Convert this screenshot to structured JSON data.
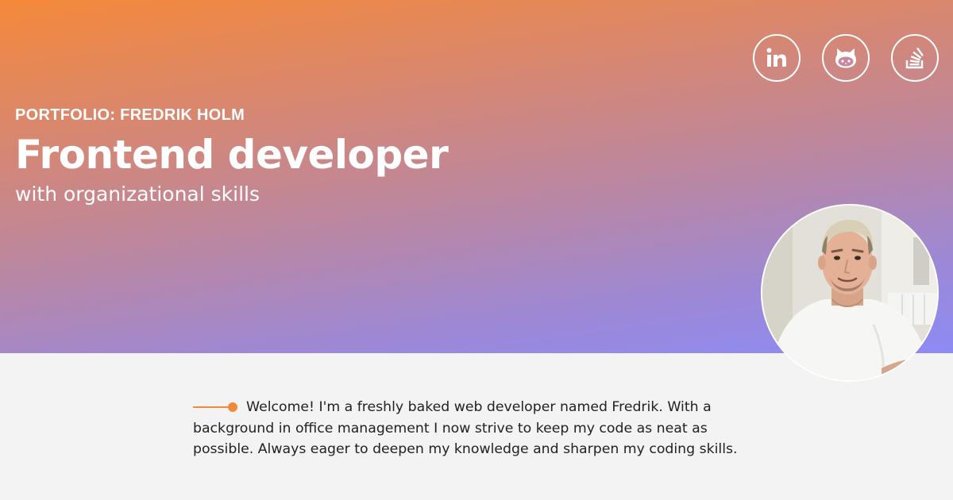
{
  "hero": {
    "eyebrow": "PORTFOLIO: FREDRIK HOLM",
    "title": "Frontend developer",
    "subtitle": "with organizational skills",
    "gradient_colors": [
      "#f5893a",
      "#8d8bf5"
    ]
  },
  "social_links": [
    {
      "name": "LinkedIn",
      "icon": "linkedin-icon"
    },
    {
      "name": "GitHub",
      "icon": "github-icon"
    },
    {
      "name": "Stack Overflow",
      "icon": "stackoverflow-icon"
    }
  ],
  "avatar": {
    "alt": "Fredrik Holm"
  },
  "intro": {
    "text": "Welcome! I'm a freshly baked web developer named Fredrik. With a background in office management I now strive to keep my code as neat as possible. Always eager to deepen my knowledge and sharpen my coding skills.",
    "accent_color": "#f08a3a"
  }
}
